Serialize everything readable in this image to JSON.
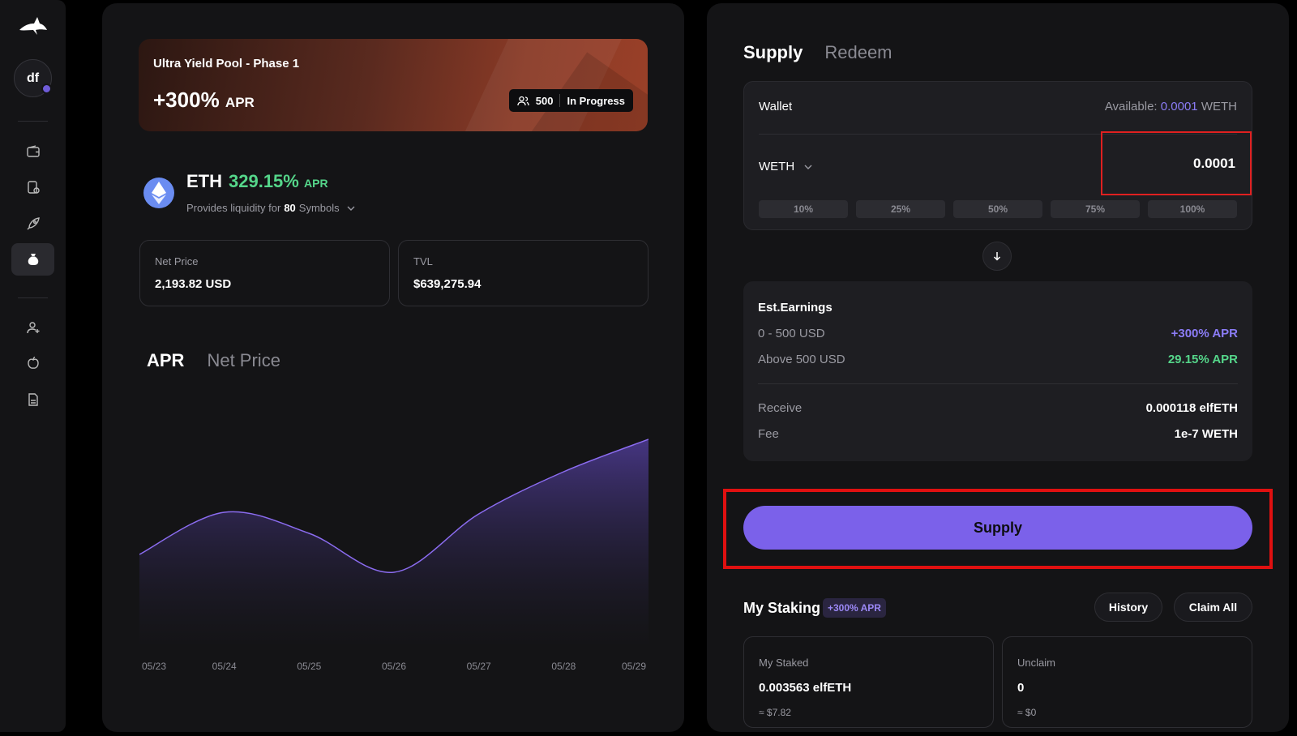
{
  "sidebar": {
    "avatar_initials": "df",
    "items": [
      {
        "icon": "wallet-icon"
      },
      {
        "icon": "tokens-icon"
      },
      {
        "icon": "rocket-icon"
      },
      {
        "icon": "money-bag-icon",
        "active": true
      },
      {
        "icon": "add-user-icon"
      },
      {
        "icon": "apple-icon"
      },
      {
        "icon": "doc-icon"
      }
    ]
  },
  "banner": {
    "title": "Ultra Yield Pool - Phase 1",
    "apr_value": "+300%",
    "apr_label": "APR",
    "participants": "500",
    "status": "In Progress"
  },
  "asset": {
    "symbol": "ETH",
    "apr_value": "329.15%",
    "apr_label": "APR",
    "provides_prefix": "Provides liquidity for",
    "symbols_count": "80",
    "symbols_label": "Symbols"
  },
  "stats": {
    "net_price_label": "Net Price",
    "net_price_value": "2,193.82 USD",
    "tvl_label": "TVL",
    "tvl_value": "$639,275.94"
  },
  "chart_tabs": {
    "apr": "APR",
    "net_price": "Net Price"
  },
  "chart_data": {
    "type": "area",
    "x": [
      "05/23",
      "05/24",
      "05/25",
      "05/26",
      "05/27",
      "05/28",
      "05/29"
    ],
    "values": [
      0.58,
      0.84,
      0.71,
      0.47,
      0.83,
      1.09,
      1.29
    ],
    "series_color": "#8b6cf0"
  },
  "supply_panel": {
    "tab_supply": "Supply",
    "tab_redeem": "Redeem",
    "wallet_label": "Wallet",
    "available_label": "Available:",
    "available_value": "0.0001",
    "available_token": "WETH",
    "token": "WETH",
    "amount": "0.0001",
    "percents": [
      "10%",
      "25%",
      "50%",
      "75%",
      "100%"
    ]
  },
  "earnings": {
    "title": "Est.Earnings",
    "tier1_label": "0 - 500 USD",
    "tier1_value": "+300% APR",
    "tier2_label": "Above 500 USD",
    "tier2_value": "29.15% APR",
    "receive_label": "Receive",
    "receive_value": "0.000118 elfETH",
    "fee_label": "Fee",
    "fee_value": "1e-7 WETH"
  },
  "supply_button": "Supply",
  "staking": {
    "title": "My Staking",
    "badge": "+300% APR",
    "history_label": "History",
    "claim_all_label": "Claim All",
    "staked_label": "My Staked",
    "staked_value": "0.003563 elfETH",
    "staked_usd": "≈ $7.82",
    "unclaim_label": "Unclaim",
    "unclaim_value": "0",
    "unclaim_usd": "≈ $0"
  },
  "colors": {
    "accent": "#7b61ea",
    "green": "#55d68a",
    "highlight_red": "#e01010"
  }
}
